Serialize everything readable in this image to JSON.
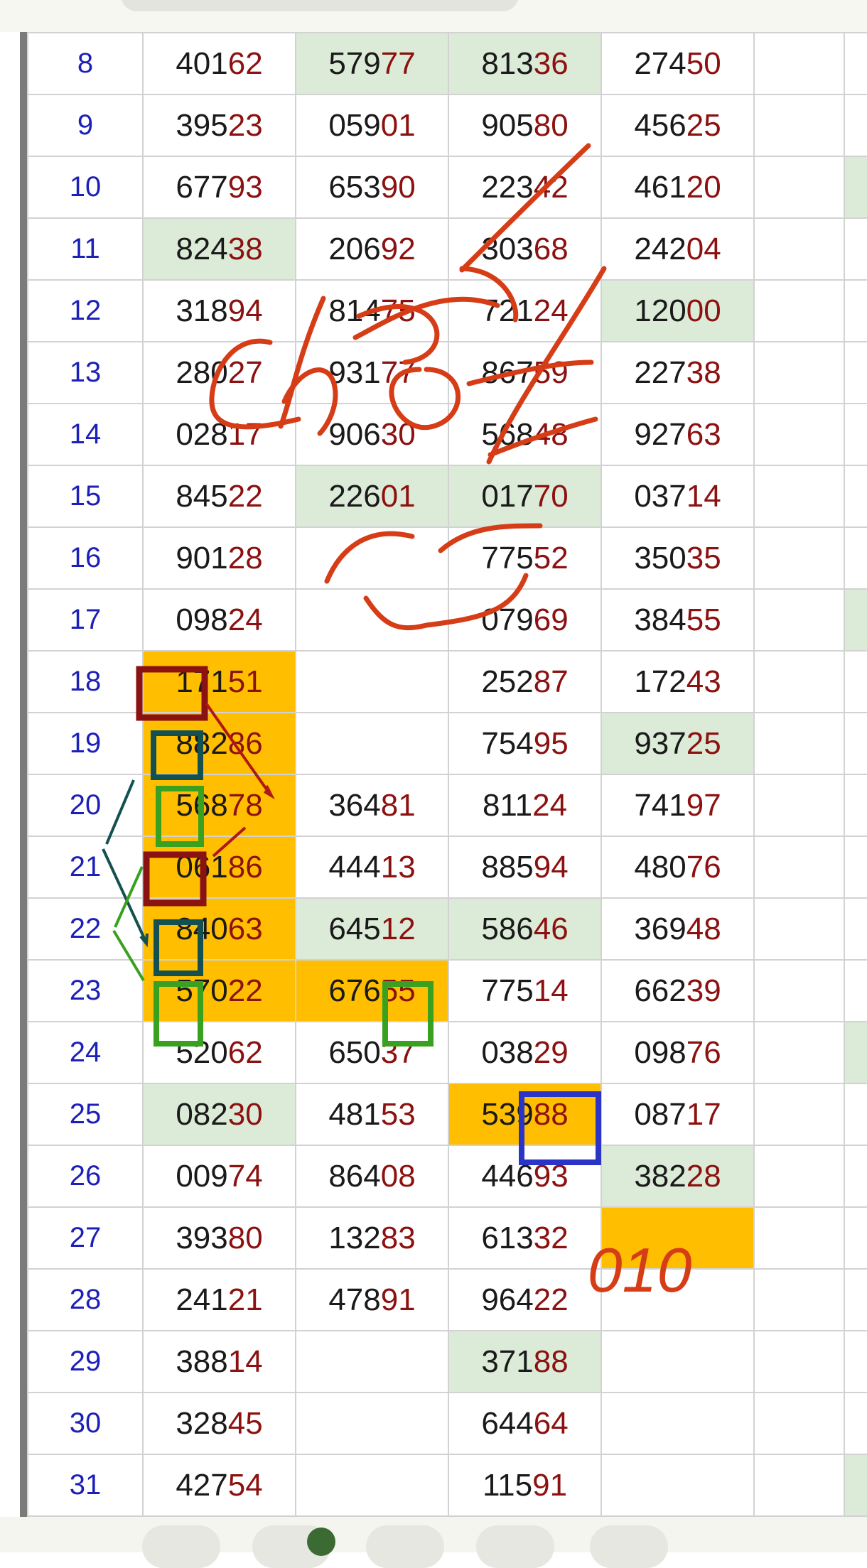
{
  "table": {
    "rows": [
      {
        "day": "8",
        "cells": [
          {
            "pre": "401",
            "hi": "62"
          },
          {
            "pre": "579",
            "hi": "77",
            "bg": "green"
          },
          {
            "pre": "813",
            "hi": "36",
            "bg": "green"
          },
          {
            "pre": "274",
            "hi": "50"
          }
        ],
        "side": ""
      },
      {
        "day": "9",
        "cells": [
          {
            "pre": "395",
            "hi": "23"
          },
          {
            "pre": "059",
            "hi": "01"
          },
          {
            "pre": "905",
            "hi": "80"
          },
          {
            "pre": "456",
            "hi": "25"
          }
        ],
        "side": ""
      },
      {
        "day": "10",
        "cells": [
          {
            "pre": "677",
            "hi": "93"
          },
          {
            "pre": "653",
            "hi": "90"
          },
          {
            "pre": "223",
            "hi": "42"
          },
          {
            "pre": "461",
            "hi": "20"
          }
        ],
        "side": "green"
      },
      {
        "day": "11",
        "cells": [
          {
            "pre": "824",
            "hi": "38",
            "bg": "green"
          },
          {
            "pre": "206",
            "hi": "92"
          },
          {
            "pre": "303",
            "hi": "68"
          },
          {
            "pre": "242",
            "hi": "04"
          }
        ],
        "side": ""
      },
      {
        "day": "12",
        "cells": [
          {
            "pre": "318",
            "hi": "94"
          },
          {
            "pre": "814",
            "hi": "75"
          },
          {
            "pre": "721",
            "hi": "24"
          },
          {
            "pre": "120",
            "hi": "00",
            "bg": "green"
          }
        ],
        "side": ""
      },
      {
        "day": "13",
        "cells": [
          {
            "pre": "280",
            "hi": "27"
          },
          {
            "pre": "931",
            "hi": "77"
          },
          {
            "pre": "867",
            "hi": "59"
          },
          {
            "pre": "227",
            "hi": "38"
          }
        ],
        "side": ""
      },
      {
        "day": "14",
        "cells": [
          {
            "pre": "028",
            "hi": "17"
          },
          {
            "pre": "906",
            "hi": "30"
          },
          {
            "pre": "568",
            "hi": "48"
          },
          {
            "pre": "927",
            "hi": "63"
          }
        ],
        "side": ""
      },
      {
        "day": "15",
        "cells": [
          {
            "pre": "845",
            "hi": "22"
          },
          {
            "pre": "226",
            "hi": "01",
            "bg": "green"
          },
          {
            "pre": "017",
            "hi": "70",
            "bg": "green"
          },
          {
            "pre": "037",
            "hi": "14"
          }
        ],
        "side": ""
      },
      {
        "day": "16",
        "cells": [
          {
            "pre": "901",
            "hi": "28"
          },
          {
            "pre": "",
            "hi": ""
          },
          {
            "pre": "775",
            "hi": "52"
          },
          {
            "pre": "350",
            "hi": "35"
          }
        ],
        "side": ""
      },
      {
        "day": "17",
        "cells": [
          {
            "pre": "098",
            "hi": "24"
          },
          {
            "pre": "",
            "hi": ""
          },
          {
            "pre": "079",
            "hi": "69"
          },
          {
            "pre": "384",
            "hi": "55"
          }
        ],
        "side": "green"
      },
      {
        "day": "18",
        "cells": [
          {
            "pre": "171",
            "hi": "51",
            "bg": "orange"
          },
          {
            "pre": "",
            "hi": ""
          },
          {
            "pre": "252",
            "hi": "87"
          },
          {
            "pre": "172",
            "hi": "43"
          }
        ],
        "side": ""
      },
      {
        "day": "19",
        "cells": [
          {
            "pre": "882",
            "hi": "86",
            "bg": "orange"
          },
          {
            "pre": "",
            "hi": ""
          },
          {
            "pre": "754",
            "hi": "95"
          },
          {
            "pre": "937",
            "hi": "25",
            "bg": "green"
          }
        ],
        "side": ""
      },
      {
        "day": "20",
        "cells": [
          {
            "pre": "568",
            "hi": "78",
            "bg": "orange"
          },
          {
            "pre": "364",
            "hi": "81"
          },
          {
            "pre": "811",
            "hi": "24"
          },
          {
            "pre": "741",
            "hi": "97"
          }
        ],
        "side": ""
      },
      {
        "day": "21",
        "cells": [
          {
            "pre": "061",
            "hi": "86",
            "bg": "orange"
          },
          {
            "pre": "444",
            "hi": "13"
          },
          {
            "pre": "885",
            "hi": "94"
          },
          {
            "pre": "480",
            "hi": "76"
          }
        ],
        "side": ""
      },
      {
        "day": "22",
        "cells": [
          {
            "pre": "840",
            "hi": "63",
            "bg": "orange"
          },
          {
            "pre": "645",
            "hi": "12",
            "bg": "green"
          },
          {
            "pre": "586",
            "hi": "46",
            "bg": "green"
          },
          {
            "pre": "369",
            "hi": "48"
          }
        ],
        "side": ""
      },
      {
        "day": "23",
        "cells": [
          {
            "pre": "570",
            "hi": "22",
            "bg": "orange"
          },
          {
            "pre": "676",
            "hi": "55",
            "bg": "orange"
          },
          {
            "pre": "775",
            "hi": "14"
          },
          {
            "pre": "662",
            "hi": "39"
          }
        ],
        "side": ""
      },
      {
        "day": "24",
        "cells": [
          {
            "pre": "520",
            "hi": "62"
          },
          {
            "pre": "650",
            "hi": "37"
          },
          {
            "pre": "038",
            "hi": "29"
          },
          {
            "pre": "098",
            "hi": "76"
          }
        ],
        "side": "green"
      },
      {
        "day": "25",
        "cells": [
          {
            "pre": "082",
            "hi": "30",
            "bg": "green"
          },
          {
            "pre": "481",
            "hi": "53"
          },
          {
            "pre": "539",
            "hi": "88",
            "bg": "orange"
          },
          {
            "pre": "087",
            "hi": "17"
          }
        ],
        "side": ""
      },
      {
        "day": "26",
        "cells": [
          {
            "pre": "009",
            "hi": "74"
          },
          {
            "pre": "864",
            "hi": "08"
          },
          {
            "pre": "446",
            "hi": "93"
          },
          {
            "pre": "382",
            "hi": "28",
            "bg": "green"
          }
        ],
        "side": ""
      },
      {
        "day": "27",
        "cells": [
          {
            "pre": "393",
            "hi": "80"
          },
          {
            "pre": "132",
            "hi": "83"
          },
          {
            "pre": "613",
            "hi": "32"
          },
          {
            "pre": "",
            "hi": "",
            "bg": "orange"
          }
        ],
        "side": ""
      },
      {
        "day": "28",
        "cells": [
          {
            "pre": "241",
            "hi": "21"
          },
          {
            "pre": "478",
            "hi": "91"
          },
          {
            "pre": "964",
            "hi": "22"
          },
          {
            "pre": "",
            "hi": ""
          }
        ],
        "side": ""
      },
      {
        "day": "29",
        "cells": [
          {
            "pre": "388",
            "hi": "14"
          },
          {
            "pre": "",
            "hi": ""
          },
          {
            "pre": "371",
            "hi": "88",
            "bg": "green"
          },
          {
            "pre": "",
            "hi": ""
          }
        ],
        "side": ""
      },
      {
        "day": "30",
        "cells": [
          {
            "pre": "328",
            "hi": "45"
          },
          {
            "pre": "",
            "hi": ""
          },
          {
            "pre": "644",
            "hi": "64"
          },
          {
            "pre": "",
            "hi": ""
          }
        ],
        "side": ""
      },
      {
        "day": "31",
        "cells": [
          {
            "pre": "427",
            "hi": "54"
          },
          {
            "pre": "",
            "hi": ""
          },
          {
            "pre": "115",
            "hi": "91"
          },
          {
            "pre": "",
            "hi": ""
          }
        ],
        "side": "green"
      }
    ]
  },
  "annotations": {
    "handwriting_main": "chốt",
    "handwriting_cell": "010"
  },
  "colors": {
    "green_cell": "#dcebd7",
    "orange_cell": "#ffbe00",
    "highlight_digits": "#8c1111",
    "day_text": "#1d20b8",
    "ink_orange": "#d63d16"
  }
}
